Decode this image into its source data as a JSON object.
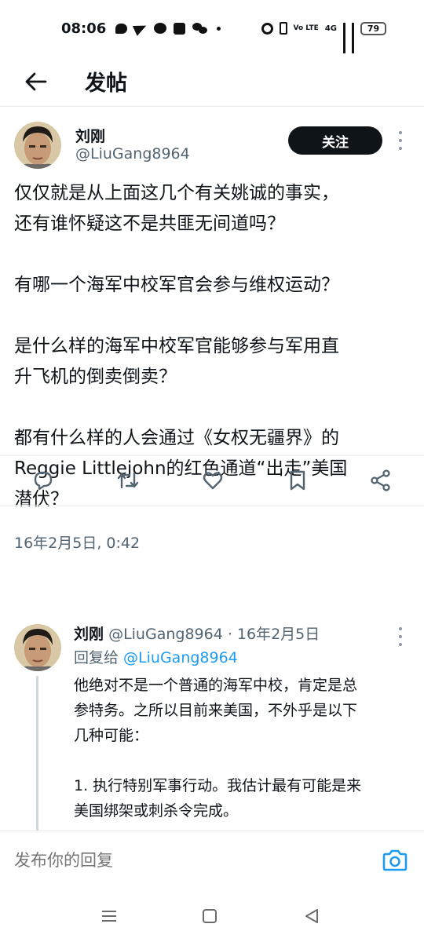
{
  "status_bar": {
    "time": "08:06",
    "network": "4G",
    "volte": "Vo LTE",
    "battery": "79"
  },
  "header": {
    "title": "发帖"
  },
  "main_tweet": {
    "author_name": "刘刚",
    "author_handle": "@LiuGang8964",
    "follow_label": "关注",
    "lines": [
      "仅仅就是从上面这几个有关姚诚的事实，",
      "还有谁怀疑这不是共匪无间道吗？",
      "",
      " 有哪一个海军中校军官会参与维权运动？",
      "",
      " 是什么样的海军中校军官能够参与军用直",
      "升飞机的倒卖倒卖？",
      "",
      " 都有什么样的人会通过《女权无疆界》的",
      "Reggie Littlejohn的红色通道“出走”美国",
      "潜伏？"
    ],
    "date": "16年2月5日, 0:42"
  },
  "reply": {
    "author_name": "刘刚",
    "meta": "@LiuGang8964 · 16年2月5日",
    "reply_to_prefix": "回复给 ",
    "reply_to_handle": "@LiuGang8964",
    "lines": [
      "他绝对不是一个普通的海军中校，肯定是总",
      "参特务。之所以目前来美国，不外乎是以下",
      "几种可能：",
      "",
      "1. 执行特别军事行动。我估计最有可能是来",
      "美国绑架或刺杀令完成。"
    ]
  },
  "composer": {
    "placeholder": "发布你的回复"
  },
  "colors": {
    "accent": "#1d9bf0",
    "text": "#0f1419",
    "muted": "#536471",
    "follow_bg": "#0f1419"
  },
  "icons": {
    "back": "arrow-left-icon",
    "reply": "comment-icon",
    "retweet": "retweet-icon",
    "like": "heart-icon",
    "bookmark": "bookmark-icon",
    "share": "share-icon",
    "camera": "camera-icon"
  }
}
